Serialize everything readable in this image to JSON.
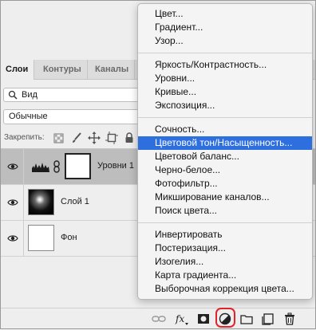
{
  "tabs": [
    {
      "label": "Слои"
    },
    {
      "label": "Контуры"
    },
    {
      "label": "Каналы"
    }
  ],
  "filter": {
    "label": "Вид"
  },
  "blend_mode": {
    "value": "Обычные"
  },
  "lock": {
    "label": "Закрепить:"
  },
  "layers": [
    {
      "name": "Уровни 1",
      "selected": true
    },
    {
      "name": "Слой 1",
      "selected": false
    },
    {
      "name": "Фон",
      "selected": false
    }
  ],
  "menu": {
    "groups": [
      [
        "Цвет...",
        "Градиент...",
        "Узор..."
      ],
      [
        "Яркость/Контрастность...",
        "Уровни...",
        "Кривые...",
        "Экспозиция..."
      ],
      [
        "Сочность...",
        "Цветовой тон/Насыщенность...",
        "Цветовой баланс...",
        "Черно-белое...",
        "Фотофильтр...",
        "Микширование каналов...",
        "Поиск цвета..."
      ],
      [
        "Инвертировать",
        "Постеризация...",
        "Изогелия...",
        "Карта градиента...",
        "Выборочная коррекция цвета..."
      ]
    ],
    "highlighted": "Цветовой тон/Насыщенность..."
  },
  "colors": {
    "menu_highlight": "#2e6fe0",
    "annotation_red": "#e3232a",
    "selected_layer": "#bdbdbd"
  }
}
